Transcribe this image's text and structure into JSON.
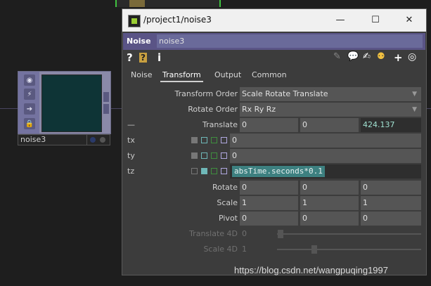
{
  "window": {
    "title": "/project1/noise3",
    "minimize": "—",
    "maximize": "☐",
    "close": "✕"
  },
  "operator": {
    "type": "Noise",
    "name": "noise3"
  },
  "node": {
    "label": "noise3"
  },
  "tabs": [
    {
      "label": "Noise"
    },
    {
      "label": "Transform",
      "active": true
    },
    {
      "label": "Output"
    },
    {
      "label": "Common"
    }
  ],
  "params": {
    "transform_order": {
      "label": "Transform Order",
      "value": "Scale Rotate Translate"
    },
    "rotate_order": {
      "label": "Rotate Order",
      "value": "Rx Ry Rz"
    },
    "translate": {
      "label": "Translate",
      "dash": "—",
      "values": [
        "0",
        "0",
        "424.137"
      ]
    },
    "tx": {
      "label": "tx",
      "value": "0"
    },
    "ty": {
      "label": "ty",
      "value": "0"
    },
    "tz": {
      "label": "tz",
      "expr": "absTime.seconds*0.1"
    },
    "rotate": {
      "label": "Rotate",
      "values": [
        "0",
        "0",
        "0"
      ]
    },
    "scale": {
      "label": "Scale",
      "values": [
        "1",
        "1",
        "1"
      ]
    },
    "pivot": {
      "label": "Pivot",
      "values": [
        "0",
        "0",
        "0"
      ]
    },
    "translate4d": {
      "label": "Translate 4D",
      "value": "0"
    },
    "scale4d": {
      "label": "Scale 4D",
      "value": "1"
    }
  },
  "icons": {
    "help": "?",
    "python_help": "?",
    "info": "i"
  },
  "watermark": "https://blog.csdn.net/wangpuqing1997"
}
